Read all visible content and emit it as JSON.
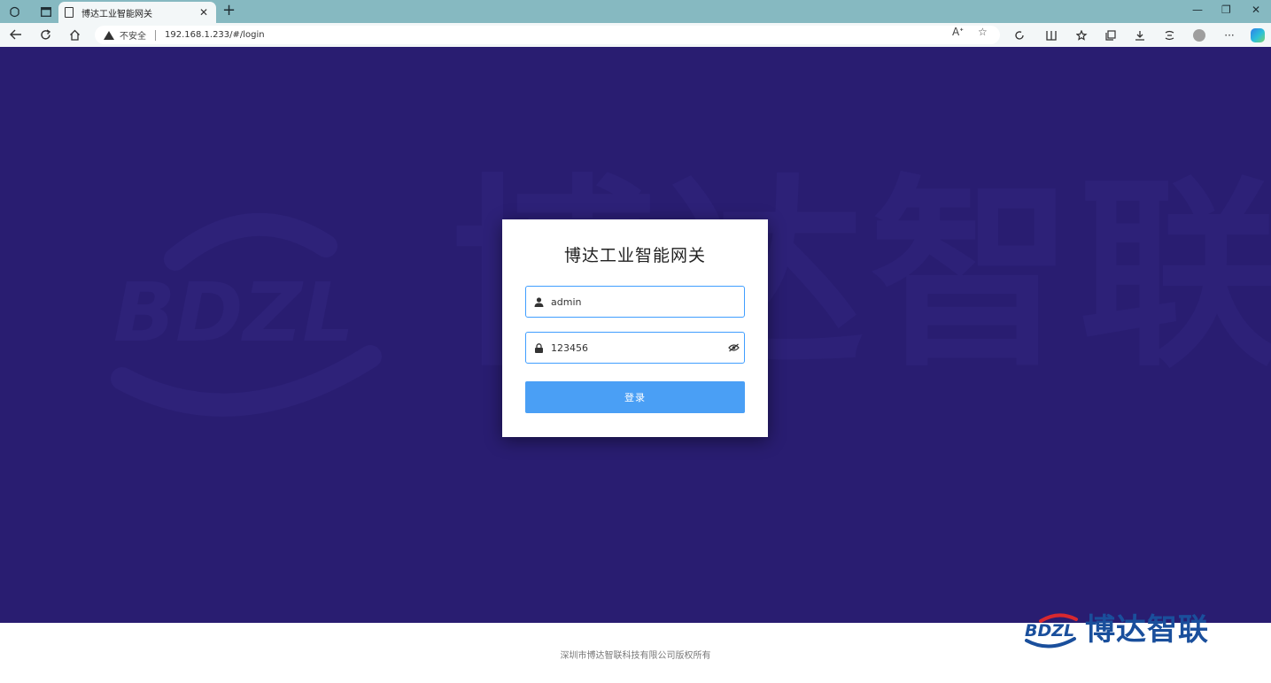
{
  "browser": {
    "tab_title": "博达工业智能网关",
    "security_label": "不安全",
    "url": "192.168.1.233/#/login"
  },
  "watermark": {
    "logo_text": "BDZL",
    "text": "博达智联"
  },
  "login": {
    "title": "博达工业智能网关",
    "username_value": "admin",
    "password_value": "123456",
    "submit_label": "登录"
  },
  "footer": {
    "copyright": "深圳市博达智联科技有限公司版权所有",
    "brand_logo_text": "BDZL",
    "brand_name": "博达智联"
  },
  "colors": {
    "background": "#291d71",
    "accent": "#409eff",
    "button": "#4a9ff5",
    "brand": "#1a4f9c"
  }
}
